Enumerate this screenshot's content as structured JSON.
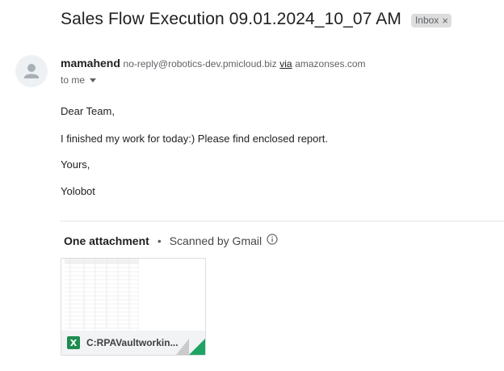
{
  "email": {
    "subject": "Sales Flow Execution 09.01.2024_10_07 AM",
    "label": "Inbox",
    "label_remove": "×",
    "sender_name": "mamahend",
    "sender_email": "no-reply@robotics-dev.pmicloud.biz",
    "via": "via",
    "via_domain": "amazonses.com",
    "recipient": "to me",
    "body": [
      "Dear Team,",
      "I finished my work for today:) Please find enclosed report.",
      "Yours,",
      "Yolobot"
    ]
  },
  "attachments": {
    "count_label": "One attachment",
    "separator": "•",
    "scan_label": "Scanned by Gmail",
    "file": {
      "type_badge": "X",
      "name": "C:RPAVaultworkin...",
      "icon": "excel-icon",
      "icon_color": "#1d8d4f",
      "corner_color": "#1ea362"
    }
  }
}
